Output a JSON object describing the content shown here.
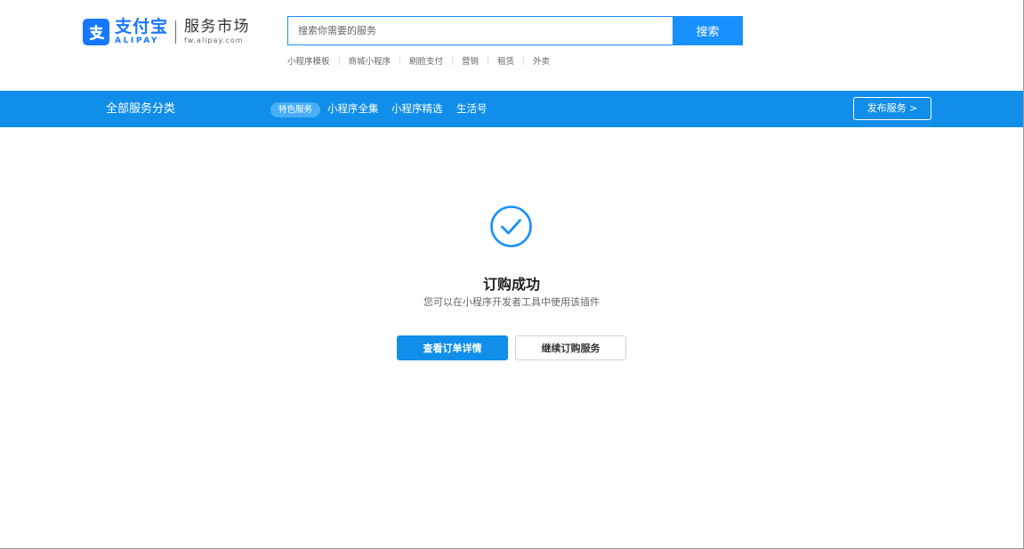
{
  "header": {
    "logo": {
      "brand_cn": "支付宝",
      "brand_en": "ALIPAY",
      "market_name": "服务市场",
      "market_url": "fw.alipay.com",
      "icon": "alipay-logo-icon"
    },
    "search": {
      "placeholder": "搜索你需要的服务",
      "value": "",
      "button_label": "搜索"
    },
    "hot_words": [
      "小程序模板",
      "商城小程序",
      "刷脸支付",
      "营销",
      "租赁",
      "外卖"
    ]
  },
  "navbar": {
    "all_categories": "全部服务分类",
    "featured_pill": "特色服务",
    "links": [
      "小程序全集",
      "小程序精选",
      "生活号"
    ],
    "publish_button": "发布服务 >"
  },
  "result": {
    "icon": "check-circle-icon",
    "title": "订购成功",
    "description": "您可以在小程序开发者工具中使用该插件",
    "primary_button": "查看订单详情",
    "secondary_button": "继续订购服务"
  },
  "colors": {
    "brand_blue": "#1677ff",
    "navbar_blue": "#108ee9",
    "search_blue": "#1890ff",
    "text_dark": "#1f1f1f",
    "text_muted": "#666666"
  }
}
